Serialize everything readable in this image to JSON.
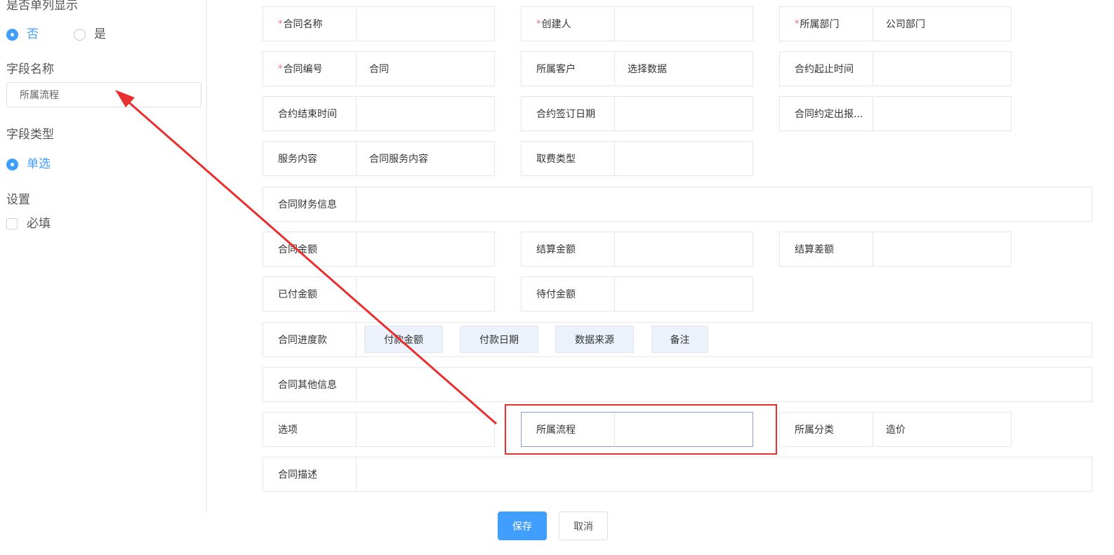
{
  "left_panel": {
    "single_col_title": "是否单列显示",
    "single_col_options": [
      "否",
      "是"
    ],
    "single_col_selected": "否",
    "field_name_title": "字段名称",
    "field_name_value": "所属流程",
    "field_type_title": "字段类型",
    "field_type_option": "单选",
    "settings_title": "设置",
    "required_label": "必填",
    "required_checked": false
  },
  "form": {
    "rows": [
      [
        {
          "label": "合同名称",
          "required": true,
          "value": ""
        },
        {
          "label": "创建人",
          "required": true,
          "value": ""
        },
        {
          "label": "所属部门",
          "required": true,
          "value": "公司部门"
        }
      ],
      [
        {
          "label": "合同编号",
          "required": true,
          "value": "合同"
        },
        {
          "label": "所属客户",
          "required": false,
          "value": "选择数据"
        },
        {
          "label": "合约起止时间",
          "required": false,
          "value": ""
        }
      ],
      [
        {
          "label": "合约结束时间",
          "required": false,
          "value": ""
        },
        {
          "label": "合约签订日期",
          "required": false,
          "value": ""
        },
        {
          "label": "合同约定出报...",
          "required": false,
          "value": ""
        }
      ],
      [
        {
          "label": "服务内容",
          "required": false,
          "value": "合同服务内容"
        },
        {
          "label": "取费类型",
          "required": false,
          "value": ""
        }
      ],
      [
        {
          "label": "合同财务信息",
          "required": false,
          "value": ""
        }
      ],
      [
        {
          "label": "合同金额",
          "required": false,
          "value": ""
        },
        {
          "label": "结算金额",
          "required": false,
          "value": ""
        },
        {
          "label": "结算差额",
          "required": false,
          "value": ""
        }
      ],
      [
        {
          "label": "已付金额",
          "required": false,
          "value": ""
        },
        {
          "label": "待付金额",
          "required": false,
          "value": ""
        }
      ],
      [
        {
          "label": "合同进度款",
          "required": false,
          "value": "",
          "subcolumns": [
            "付款金额",
            "付款日期",
            "数据来源",
            "备注"
          ]
        }
      ],
      [
        {
          "label": "合同其他信息",
          "required": false,
          "value": ""
        }
      ],
      [
        {
          "label": "选项",
          "required": false,
          "value": ""
        },
        {
          "label": "所属流程",
          "required": false,
          "value": "",
          "selected": true
        },
        {
          "label": "所属分类",
          "required": false,
          "value": "造价"
        }
      ],
      [
        {
          "label": "合同描述",
          "required": false,
          "value": ""
        }
      ]
    ]
  },
  "buttons": {
    "save": "保存",
    "cancel": "取消"
  },
  "colors": {
    "primary": "#409eff",
    "required_mark": "#f56c6c",
    "annotation": "#e8302e"
  }
}
